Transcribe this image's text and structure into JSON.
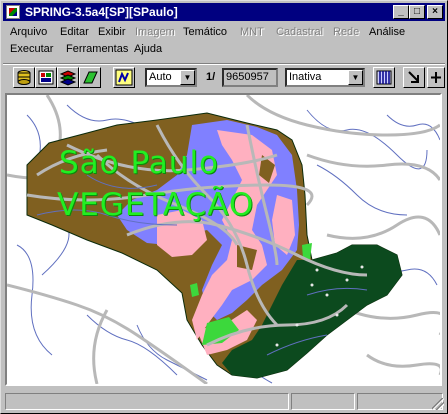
{
  "window": {
    "title": "SPRING-3.5a4[SP][SPaulo]",
    "controls": [
      "_",
      "□",
      "×"
    ]
  },
  "menu": {
    "row1": [
      {
        "label": "Arquivo",
        "enabled": true
      },
      {
        "label": "Editar",
        "enabled": true
      },
      {
        "label": "Exibir",
        "enabled": true
      },
      {
        "label": "Imagem",
        "enabled": false
      },
      {
        "label": "Temático",
        "enabled": true
      },
      {
        "label": "MNT",
        "enabled": false
      },
      {
        "label": "Cadastral",
        "enabled": false
      },
      {
        "label": "Rede",
        "enabled": false
      },
      {
        "label": "Análise",
        "enabled": true
      }
    ],
    "row2": [
      {
        "label": "Executar",
        "enabled": true
      },
      {
        "label": "Ferramentas",
        "enabled": true
      },
      {
        "label": "Ajuda",
        "enabled": true
      }
    ]
  },
  "toolbar": {
    "scale_mode": "Auto",
    "scale_prefix": "1/",
    "scale_value": "9650957",
    "state": "Inativa"
  },
  "map": {
    "title": "São Paulo",
    "subtitle": "VEGETAÇÃO",
    "colors": {
      "land_brown": "#806020",
      "periwinkle": "#8080ff",
      "pink": "#ffb0c0",
      "dark_green": "#0c4a1e",
      "bright_green": "#3cd83c",
      "roads": "#b8b8b8",
      "rivers": "#6070c0",
      "text_green": "#22ee22"
    }
  }
}
